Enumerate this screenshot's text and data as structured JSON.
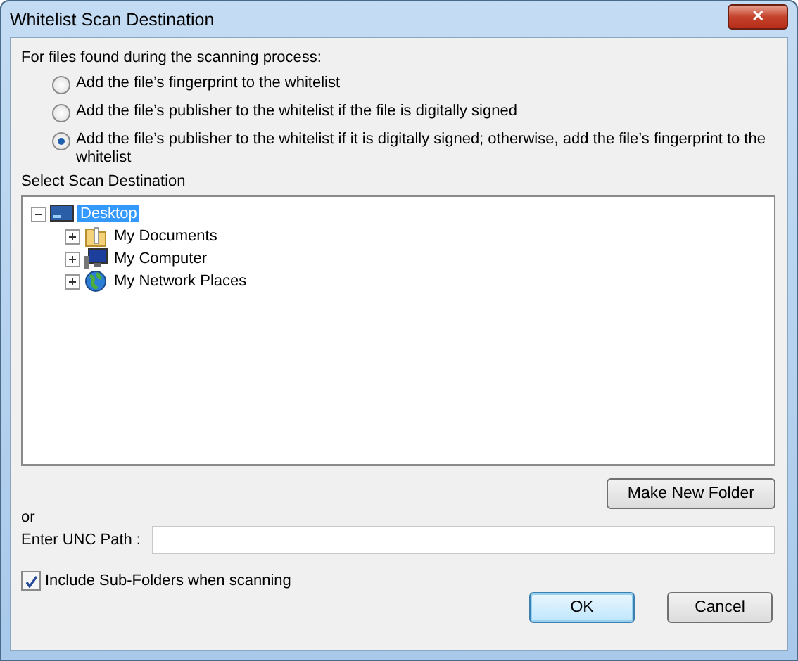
{
  "window": {
    "title": "Whitelist Scan Destination",
    "close": "✕"
  },
  "prompt": "For files found during the scanning process:",
  "options": [
    {
      "label": "Add the file’s fingerprint to the whitelist",
      "selected": false
    },
    {
      "label": "Add the file’s publisher to the whitelist if the file is digitally signed",
      "selected": false
    },
    {
      "label": "Add the file’s publisher to the whitelist if it is digitally signed; otherwise, add the file’s fingerprint to the whitelist",
      "selected": true
    }
  ],
  "tree_label": "Select Scan Destination",
  "tree": [
    {
      "label": "Desktop",
      "kind": "desktop",
      "expanded": true,
      "selected": true,
      "children": [
        {
          "label": "My Documents",
          "kind": "folder",
          "expanded": false,
          "selected": false
        },
        {
          "label": "My Computer",
          "kind": "computer",
          "expanded": false,
          "selected": false
        },
        {
          "label": "My Network Places",
          "kind": "network",
          "expanded": false,
          "selected": false
        }
      ]
    }
  ],
  "make_folder": "Make New Folder",
  "or": "or",
  "unc": {
    "label": "Enter UNC Path :"
  },
  "subfolders": {
    "label": "Include Sub-Folders when scanning",
    "checked": true
  },
  "buttons": [
    {
      "label": "OK",
      "default": true
    },
    {
      "label": "Cancel",
      "default": false
    }
  ]
}
